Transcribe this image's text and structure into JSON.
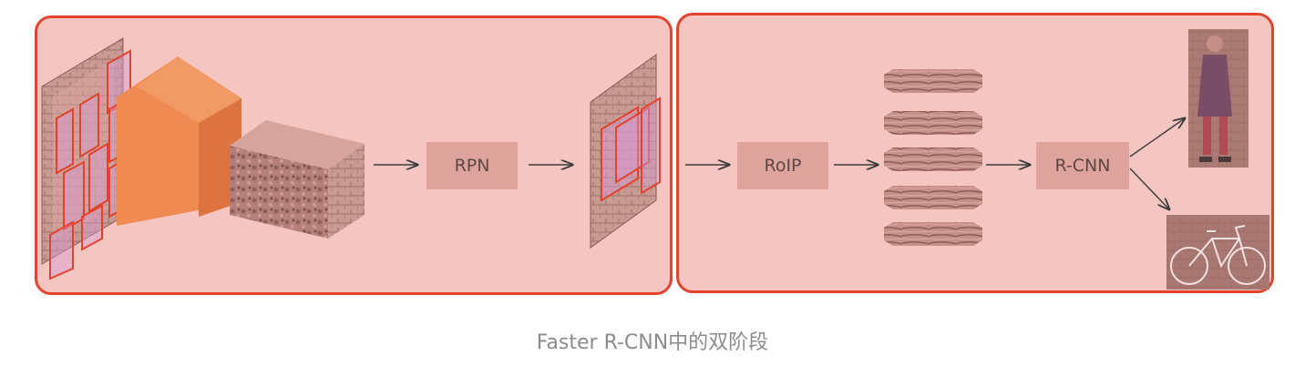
{
  "diagram": {
    "nodes": {
      "rpn": "RPN",
      "roip": "RoIP",
      "rcnn": "R-CNN"
    },
    "caption": "Faster R-CNN中的双阶段"
  },
  "colors": {
    "panel_fill": "#f5c6c1",
    "panel_border": "#e2432c",
    "node_fill": "#dda39c",
    "cnn_block": "#ee8a52",
    "arrow": "#3b3b3b"
  }
}
